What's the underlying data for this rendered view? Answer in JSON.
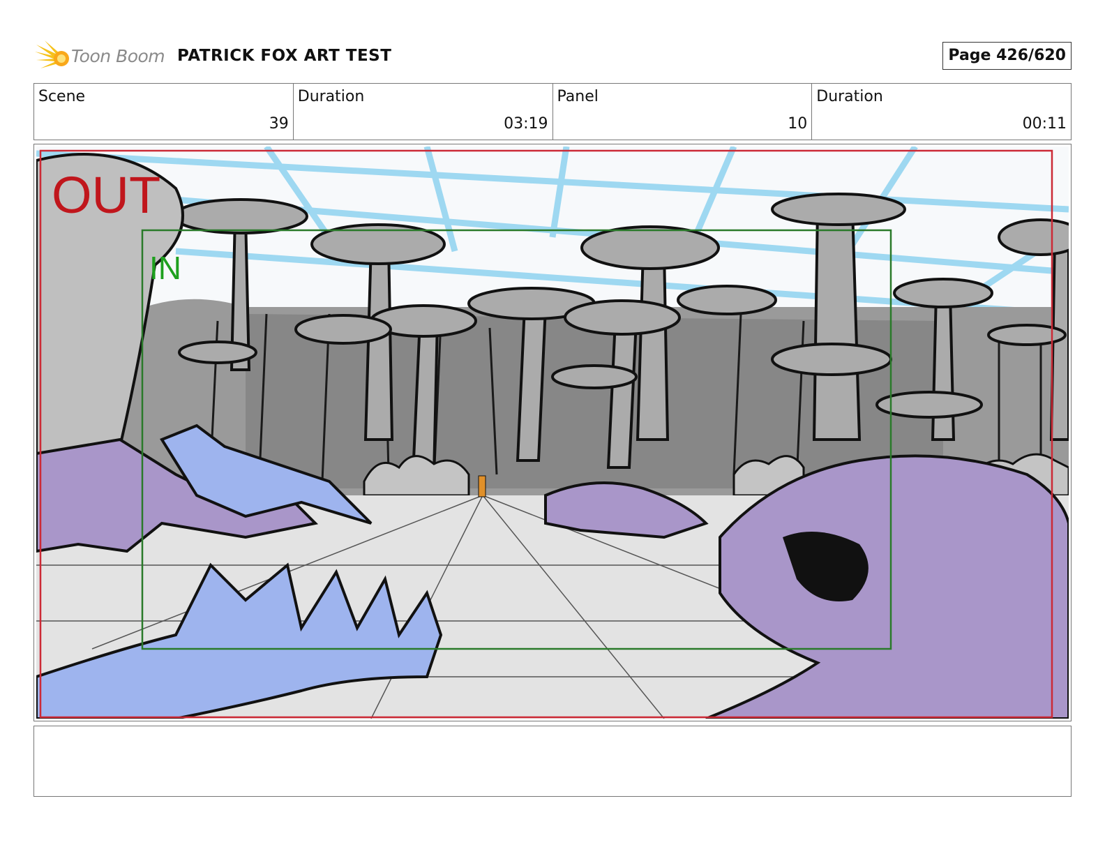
{
  "header": {
    "logo_text": "Toon Boom",
    "title": "PATRICK FOX ART TEST",
    "page": "Page 426/620"
  },
  "info": {
    "scene_label": "Scene",
    "scene_value": "39",
    "duration1_label": "Duration",
    "duration1_value": "03:19",
    "panel_label": "Panel",
    "panel_value": "10",
    "duration2_label": "Duration",
    "duration2_value": "00:11"
  },
  "frame": {
    "out_label": "OUT",
    "in_label": "IN"
  },
  "colors": {
    "out_frame": "#cc2a36",
    "in_frame": "#2a7a2a",
    "grid_blue": "#8fd3f0",
    "monster_purple": "#a996c9",
    "monster_blue": "#9eb4ee",
    "stone_gray": "#a9a9a9"
  },
  "notes": ""
}
